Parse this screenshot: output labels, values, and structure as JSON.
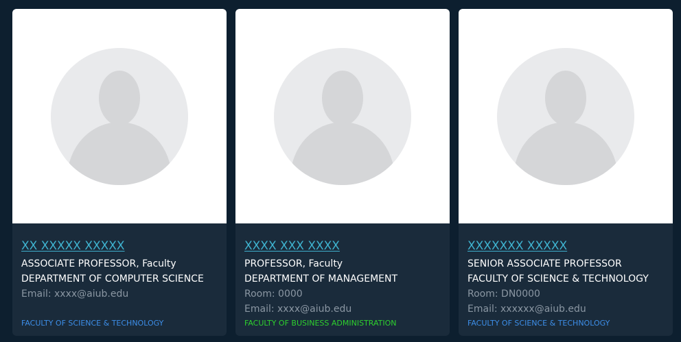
{
  "colors": {
    "name_link": "#3fb3d0",
    "faculty_science": "#3d8ee8",
    "faculty_business": "#2ed12e",
    "card_bg": "#1a2b3b",
    "page_bg": "#0d1f2f"
  },
  "cards": [
    {
      "avatar_icon": "avatar-placeholder-icon",
      "name": "XX XXXXX XXXXX",
      "title": "ASSOCIATE PROFESSOR, Faculty",
      "department": "DEPARTMENT OF COMPUTER SCIENCE",
      "room": "",
      "email": "Email: xxxx@aiub.edu",
      "faculty": "FACULTY OF SCIENCE & TECHNOLOGY",
      "faculty_color": "#3d8ee8"
    },
    {
      "avatar_icon": "avatar-placeholder-icon",
      "name": "XXXX XXX XXXX",
      "title": "PROFESSOR, Faculty",
      "department": "DEPARTMENT OF MANAGEMENT",
      "room": "Room: 0000",
      "email": "Email: xxxx@aiub.edu",
      "faculty": "FACULTY OF BUSINESS ADMINISTRATION",
      "faculty_color": "#2ed12e"
    },
    {
      "avatar_icon": "avatar-placeholder-icon",
      "name": "XXXXXXX XXXXX",
      "title": "SENIOR ASSOCIATE PROFESSOR",
      "department": "FACULTY OF SCIENCE & TECHNOLOGY",
      "room": "Room: DN0000",
      "email": "Email: xxxxxx@aiub.edu",
      "faculty": "FACULTY OF SCIENCE & TECHNOLOGY",
      "faculty_color": "#3d8ee8"
    }
  ]
}
